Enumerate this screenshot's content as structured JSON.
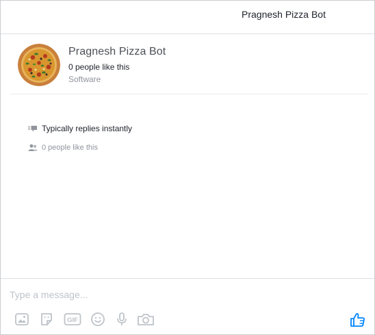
{
  "header": {
    "title": "Pragnesh Pizza Bot"
  },
  "profile": {
    "name": "Pragnesh Pizza Bot",
    "likes": "0 people like this",
    "category": "Software",
    "avatar_icon": "pizza-avatar"
  },
  "info": {
    "replies": "Typically replies instantly",
    "likes": "0 people like this"
  },
  "composer": {
    "placeholder": "Type a message...",
    "tools": [
      "photo-icon",
      "sticker-icon",
      "gif-icon",
      "emoji-icon",
      "microphone-icon",
      "camera-icon"
    ],
    "gif_label": "GIF",
    "send_icon": "thumbs-up-icon"
  },
  "colors": {
    "accent": "#0084ff",
    "toolbar_icon": "#bec3c9",
    "muted_text": "#90949c",
    "name_text": "#4b4f56"
  }
}
